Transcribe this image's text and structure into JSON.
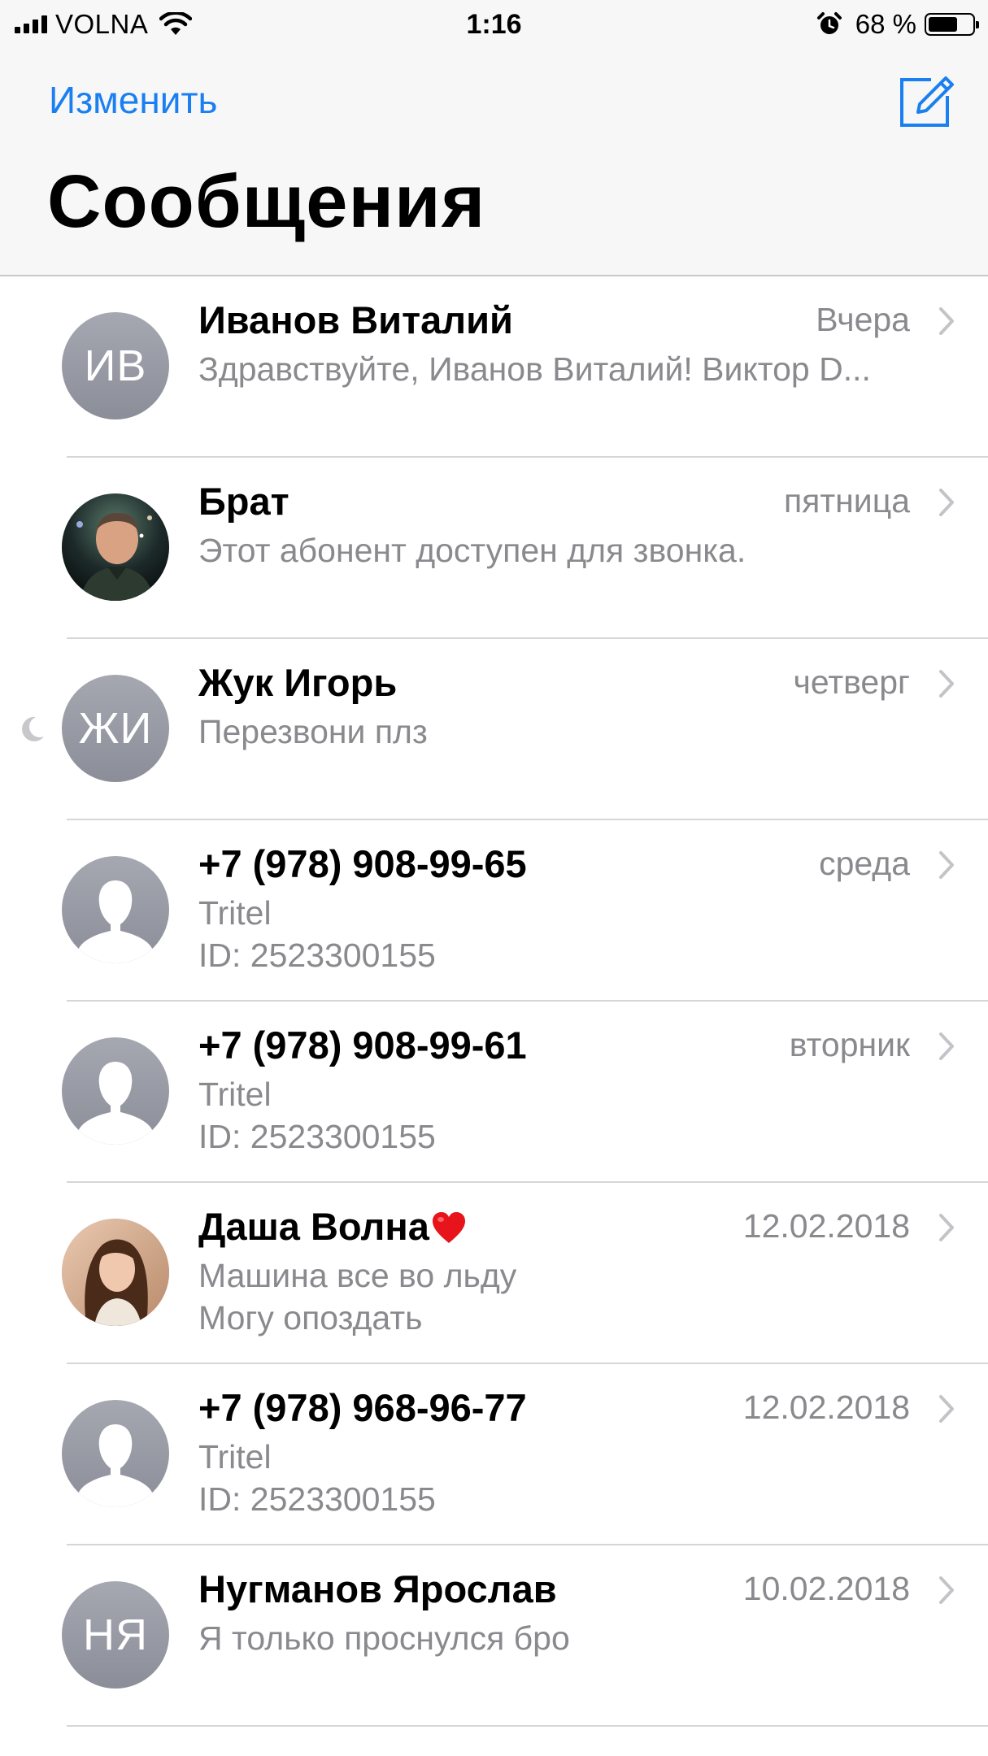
{
  "status_bar": {
    "carrier": "VOLNA",
    "time": "1:16",
    "battery": "68 %",
    "battery_level": 0.68,
    "icons": [
      "signal-icon",
      "wifi-icon",
      "alarm-icon",
      "battery-icon"
    ]
  },
  "header": {
    "edit_label": "Изменить",
    "title": "Сообщения",
    "compose_icon": "compose-icon"
  },
  "colors": {
    "accent": "#1a7ff0",
    "secondary_text": "#8a8a8e",
    "avatar_gray": "#9a9da6"
  },
  "conversations": [
    {
      "name": "Иванов Виталий",
      "date": "Вчера",
      "avatar": "initials",
      "initials": "ИВ",
      "preview": [
        "Здравствуйте, Иванов Виталий! Виктор D..."
      ]
    },
    {
      "name": "Брат",
      "date": "пятница",
      "avatar": "photo",
      "preview": [
        "Этот абонент доступен для звонка."
      ]
    },
    {
      "name": "Жук Игорь",
      "date": "четверг",
      "avatar": "initials",
      "initials": "ЖИ",
      "preview": [
        "Перезвони плз"
      ],
      "do_not_disturb": true
    },
    {
      "name": "+7 (978) 908-99-65",
      "date": "среда",
      "avatar": "silhouette",
      "preview": [
        "Tritel",
        "ID: 2523300155"
      ]
    },
    {
      "name": "+7 (978) 908-99-61",
      "date": "вторник",
      "avatar": "silhouette",
      "preview": [
        "Tritel",
        "ID: 2523300155"
      ]
    },
    {
      "name": "Даша Волна",
      "date": "12.02.2018",
      "avatar": "photo",
      "name_emoji": "heart-icon",
      "preview": [
        "Машина все во льду",
        "Могу опоздать"
      ]
    },
    {
      "name": "+7 (978) 968-96-77",
      "date": "12.02.2018",
      "avatar": "silhouette",
      "preview": [
        "Tritel",
        "ID: 2523300155"
      ]
    },
    {
      "name": "Нугманов Ярослав",
      "date": "10.02.2018",
      "avatar": "initials",
      "initials": "НЯ",
      "preview": [
        "Я только проснулся бро"
      ]
    }
  ]
}
